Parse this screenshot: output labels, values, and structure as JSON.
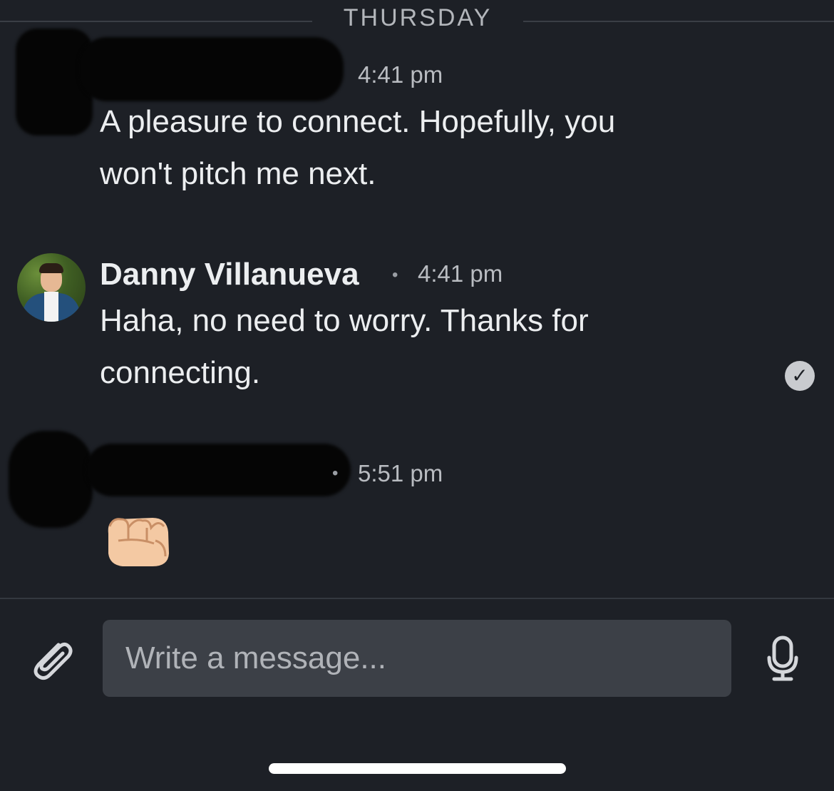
{
  "divider": {
    "label": "THURSDAY"
  },
  "messages": [
    {
      "time": "4:41 pm",
      "text_line1": "A pleasure to connect. Hopefully, you",
      "text_line2": "won't pitch me next."
    },
    {
      "sender": "Danny Villanueva",
      "separator": "•",
      "time": "4:41 pm",
      "text_line1": "Haha, no need to worry. Thanks for",
      "text_line2": "connecting.",
      "status_icon": "read-check-icon"
    },
    {
      "separator": "•",
      "time": "5:51 pm",
      "emoji": "fist-bump-emoji"
    }
  ],
  "composer": {
    "placeholder": "Write a message...",
    "attach_icon": "paperclip-icon",
    "mic_icon": "microphone-icon"
  },
  "colors": {
    "background": "#1d2026",
    "input_bg": "#3c4047",
    "text": "#eceef0",
    "muted": "#b9bcc1"
  }
}
